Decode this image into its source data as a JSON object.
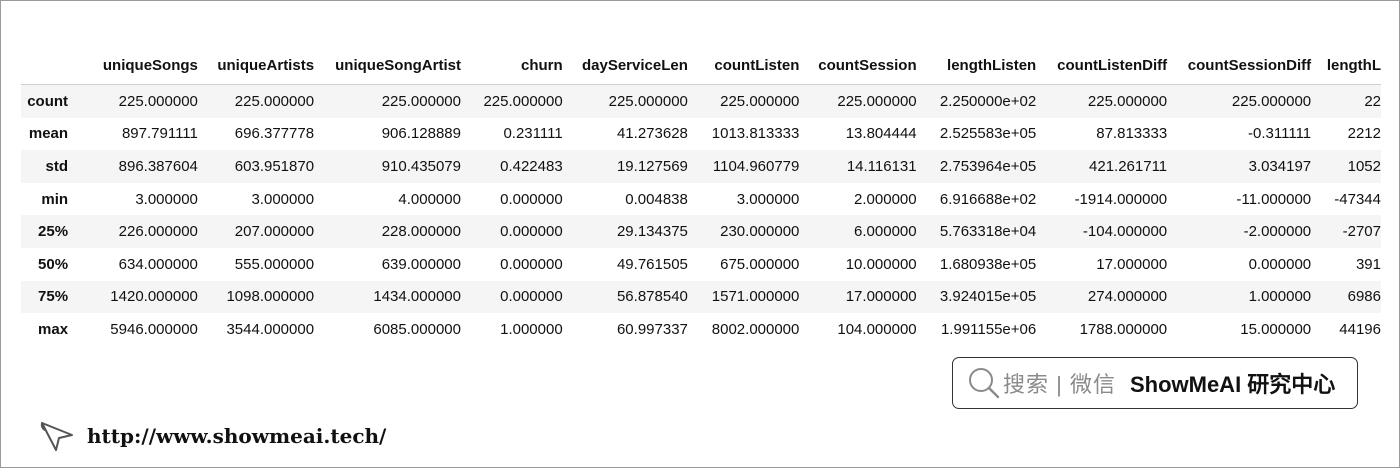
{
  "table": {
    "columns": [
      "uniqueSongs",
      "uniqueArtists",
      "uniqueSongArtist",
      "churn",
      "dayServiceLen",
      "countListen",
      "countSession",
      "lengthListen",
      "countListenDiff",
      "countSessionDiff",
      "lengthL"
    ],
    "rows": [
      {
        "label": "count",
        "cells": [
          "225.000000",
          "225.000000",
          "225.000000",
          "225.000000",
          "225.000000",
          "225.000000",
          "225.000000",
          "2.250000e+02",
          "225.000000",
          "225.000000",
          "22"
        ]
      },
      {
        "label": "mean",
        "cells": [
          "897.791111",
          "696.377778",
          "906.128889",
          "0.231111",
          "41.273628",
          "1013.813333",
          "13.804444",
          "2.525583e+05",
          "87.813333",
          "-0.311111",
          "2212"
        ]
      },
      {
        "label": "std",
        "cells": [
          "896.387604",
          "603.951870",
          "910.435079",
          "0.422483",
          "19.127569",
          "1104.960779",
          "14.116131",
          "2.753964e+05",
          "421.261711",
          "3.034197",
          "1052"
        ]
      },
      {
        "label": "min",
        "cells": [
          "3.000000",
          "3.000000",
          "4.000000",
          "0.000000",
          "0.004838",
          "3.000000",
          "2.000000",
          "6.916688e+02",
          "-1914.000000",
          "-11.000000",
          "-47344"
        ]
      },
      {
        "label": "25%",
        "cells": [
          "226.000000",
          "207.000000",
          "228.000000",
          "0.000000",
          "29.134375",
          "230.000000",
          "6.000000",
          "5.763318e+04",
          "-104.000000",
          "-2.000000",
          "-2707"
        ]
      },
      {
        "label": "50%",
        "cells": [
          "634.000000",
          "555.000000",
          "639.000000",
          "0.000000",
          "49.761505",
          "675.000000",
          "10.000000",
          "1.680938e+05",
          "17.000000",
          "0.000000",
          "391"
        ]
      },
      {
        "label": "75%",
        "cells": [
          "1420.000000",
          "1098.000000",
          "1434.000000",
          "0.000000",
          "56.878540",
          "1571.000000",
          "17.000000",
          "3.924015e+05",
          "274.000000",
          "1.000000",
          "6986"
        ]
      },
      {
        "label": "max",
        "cells": [
          "5946.000000",
          "3544.000000",
          "6085.000000",
          "1.000000",
          "60.997337",
          "8002.000000",
          "104.000000",
          "1.991155e+06",
          "1788.000000",
          "15.000000",
          "44196"
        ]
      }
    ]
  },
  "watermark": {
    "search_label": "搜索 | 微信",
    "brand": "ShowMeAI 研究中心",
    "icon": "search-icon"
  },
  "footer": {
    "url": "http://www.showmeai.tech/",
    "icon": "cursor-icon"
  }
}
